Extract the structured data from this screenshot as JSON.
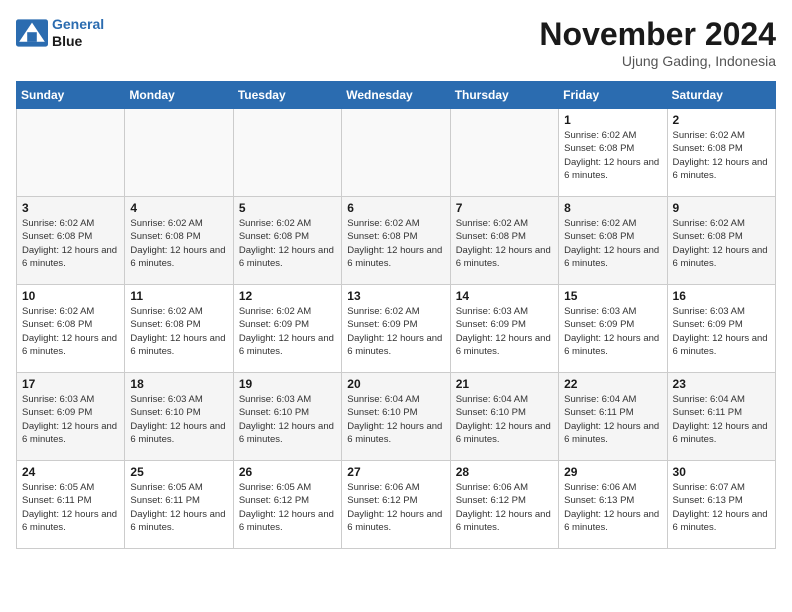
{
  "header": {
    "logo_line1": "General",
    "logo_line2": "Blue",
    "month_title": "November 2024",
    "location": "Ujung Gading, Indonesia"
  },
  "weekdays": [
    "Sunday",
    "Monday",
    "Tuesday",
    "Wednesday",
    "Thursday",
    "Friday",
    "Saturday"
  ],
  "weeks": [
    [
      {
        "day": "",
        "info": ""
      },
      {
        "day": "",
        "info": ""
      },
      {
        "day": "",
        "info": ""
      },
      {
        "day": "",
        "info": ""
      },
      {
        "day": "",
        "info": ""
      },
      {
        "day": "1",
        "info": "Sunrise: 6:02 AM\nSunset: 6:08 PM\nDaylight: 12 hours and 6 minutes."
      },
      {
        "day": "2",
        "info": "Sunrise: 6:02 AM\nSunset: 6:08 PM\nDaylight: 12 hours and 6 minutes."
      }
    ],
    [
      {
        "day": "3",
        "info": "Sunrise: 6:02 AM\nSunset: 6:08 PM\nDaylight: 12 hours and 6 minutes."
      },
      {
        "day": "4",
        "info": "Sunrise: 6:02 AM\nSunset: 6:08 PM\nDaylight: 12 hours and 6 minutes."
      },
      {
        "day": "5",
        "info": "Sunrise: 6:02 AM\nSunset: 6:08 PM\nDaylight: 12 hours and 6 minutes."
      },
      {
        "day": "6",
        "info": "Sunrise: 6:02 AM\nSunset: 6:08 PM\nDaylight: 12 hours and 6 minutes."
      },
      {
        "day": "7",
        "info": "Sunrise: 6:02 AM\nSunset: 6:08 PM\nDaylight: 12 hours and 6 minutes."
      },
      {
        "day": "8",
        "info": "Sunrise: 6:02 AM\nSunset: 6:08 PM\nDaylight: 12 hours and 6 minutes."
      },
      {
        "day": "9",
        "info": "Sunrise: 6:02 AM\nSunset: 6:08 PM\nDaylight: 12 hours and 6 minutes."
      }
    ],
    [
      {
        "day": "10",
        "info": "Sunrise: 6:02 AM\nSunset: 6:08 PM\nDaylight: 12 hours and 6 minutes."
      },
      {
        "day": "11",
        "info": "Sunrise: 6:02 AM\nSunset: 6:08 PM\nDaylight: 12 hours and 6 minutes."
      },
      {
        "day": "12",
        "info": "Sunrise: 6:02 AM\nSunset: 6:09 PM\nDaylight: 12 hours and 6 minutes."
      },
      {
        "day": "13",
        "info": "Sunrise: 6:02 AM\nSunset: 6:09 PM\nDaylight: 12 hours and 6 minutes."
      },
      {
        "day": "14",
        "info": "Sunrise: 6:03 AM\nSunset: 6:09 PM\nDaylight: 12 hours and 6 minutes."
      },
      {
        "day": "15",
        "info": "Sunrise: 6:03 AM\nSunset: 6:09 PM\nDaylight: 12 hours and 6 minutes."
      },
      {
        "day": "16",
        "info": "Sunrise: 6:03 AM\nSunset: 6:09 PM\nDaylight: 12 hours and 6 minutes."
      }
    ],
    [
      {
        "day": "17",
        "info": "Sunrise: 6:03 AM\nSunset: 6:09 PM\nDaylight: 12 hours and 6 minutes."
      },
      {
        "day": "18",
        "info": "Sunrise: 6:03 AM\nSunset: 6:10 PM\nDaylight: 12 hours and 6 minutes."
      },
      {
        "day": "19",
        "info": "Sunrise: 6:03 AM\nSunset: 6:10 PM\nDaylight: 12 hours and 6 minutes."
      },
      {
        "day": "20",
        "info": "Sunrise: 6:04 AM\nSunset: 6:10 PM\nDaylight: 12 hours and 6 minutes."
      },
      {
        "day": "21",
        "info": "Sunrise: 6:04 AM\nSunset: 6:10 PM\nDaylight: 12 hours and 6 minutes."
      },
      {
        "day": "22",
        "info": "Sunrise: 6:04 AM\nSunset: 6:11 PM\nDaylight: 12 hours and 6 minutes."
      },
      {
        "day": "23",
        "info": "Sunrise: 6:04 AM\nSunset: 6:11 PM\nDaylight: 12 hours and 6 minutes."
      }
    ],
    [
      {
        "day": "24",
        "info": "Sunrise: 6:05 AM\nSunset: 6:11 PM\nDaylight: 12 hours and 6 minutes."
      },
      {
        "day": "25",
        "info": "Sunrise: 6:05 AM\nSunset: 6:11 PM\nDaylight: 12 hours and 6 minutes."
      },
      {
        "day": "26",
        "info": "Sunrise: 6:05 AM\nSunset: 6:12 PM\nDaylight: 12 hours and 6 minutes."
      },
      {
        "day": "27",
        "info": "Sunrise: 6:06 AM\nSunset: 6:12 PM\nDaylight: 12 hours and 6 minutes."
      },
      {
        "day": "28",
        "info": "Sunrise: 6:06 AM\nSunset: 6:12 PM\nDaylight: 12 hours and 6 minutes."
      },
      {
        "day": "29",
        "info": "Sunrise: 6:06 AM\nSunset: 6:13 PM\nDaylight: 12 hours and 6 minutes."
      },
      {
        "day": "30",
        "info": "Sunrise: 6:07 AM\nSunset: 6:13 PM\nDaylight: 12 hours and 6 minutes."
      }
    ]
  ]
}
